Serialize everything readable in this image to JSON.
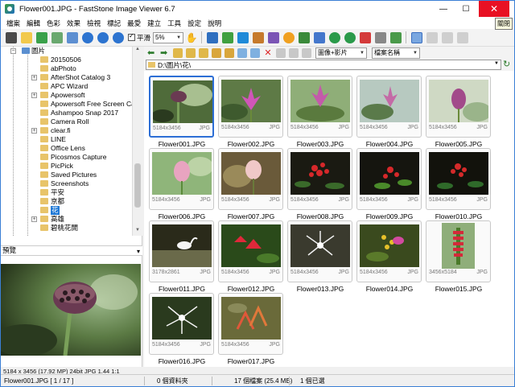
{
  "window": {
    "title": "Flower001.JPG  -  FastStone Image Viewer 6.7",
    "tooltip": "關閉"
  },
  "menu": [
    "檔案",
    "編輯",
    "色彩",
    "效果",
    "檢視",
    "標記",
    "最愛",
    "建立",
    "工具",
    "設定",
    "說明"
  ],
  "toolbar": {
    "smooth_label": "平滑",
    "zoom_value": "5%",
    "filter_value": "圖像+影片",
    "sort_value": "檔案名稱"
  },
  "tree": {
    "root": "圖片",
    "items": [
      "20150506",
      "abPhoto",
      "AfterShot Catalog 3",
      "APC Wizard",
      "Apowersoft",
      "Apowersoft Free Screen Capt",
      "Ashampoo Snap 2017",
      "Camera Roll",
      "clear.fi",
      "LINE",
      "Office Lens",
      "Picosmos Capture",
      "PicPick",
      "Saved Pictures",
      "Screenshots",
      "平安",
      "京都",
      "花",
      "高雄",
      "碧桃花開"
    ],
    "selected": "花"
  },
  "preview": {
    "title": "預覽",
    "info": "5184 x 3456 (17.92 MP)  24bit  JPG   1.44  1:1"
  },
  "address": {
    "path": "D:\\圖片\\花\\"
  },
  "thumbnails": [
    {
      "name": "Flower001.JPG",
      "dims": "5184x3456",
      "fmt": "JPG"
    },
    {
      "name": "Flower002.JPG",
      "dims": "5184x3456",
      "fmt": "JPG"
    },
    {
      "name": "Flower003.JPG",
      "dims": "5184x3456",
      "fmt": "JPG"
    },
    {
      "name": "Flower004.JPG",
      "dims": "5184x3456",
      "fmt": "JPG"
    },
    {
      "name": "Flower005.JPG",
      "dims": "5184x3456",
      "fmt": "JPG"
    },
    {
      "name": "Flower006.JPG",
      "dims": "5184x3456",
      "fmt": "JPG"
    },
    {
      "name": "Flower007.JPG",
      "dims": "5184x3456",
      "fmt": "JPG"
    },
    {
      "name": "Flower008.JPG",
      "dims": "5184x3456",
      "fmt": "JPG"
    },
    {
      "name": "Flower009.JPG",
      "dims": "5184x3456",
      "fmt": "JPG"
    },
    {
      "name": "Flower010.JPG",
      "dims": "5184x3456",
      "fmt": "JPG"
    },
    {
      "name": "Flower011.JPG",
      "dims": "3178x2861",
      "fmt": "JPG"
    },
    {
      "name": "Flower012.JPG",
      "dims": "5184x3456",
      "fmt": "JPG"
    },
    {
      "name": "Flower013.JPG",
      "dims": "5184x3456",
      "fmt": "JPG"
    },
    {
      "name": "Flower014.JPG",
      "dims": "5184x3456",
      "fmt": "JPG"
    },
    {
      "name": "Flower015.JPG",
      "dims": "3456x5184",
      "fmt": "JPG"
    },
    {
      "name": "Flower016.JPG",
      "dims": "5184x3456",
      "fmt": "JPG"
    },
    {
      "name": "Flower017.JPG",
      "dims": "5184x3456",
      "fmt": "JPG"
    }
  ],
  "status": {
    "file": "Flower001.JPG [ 1 / 17 ]",
    "folders": "0 個資料夾",
    "files": "17 個檔案 (25.4 MB)",
    "selected": "1 個已選"
  }
}
